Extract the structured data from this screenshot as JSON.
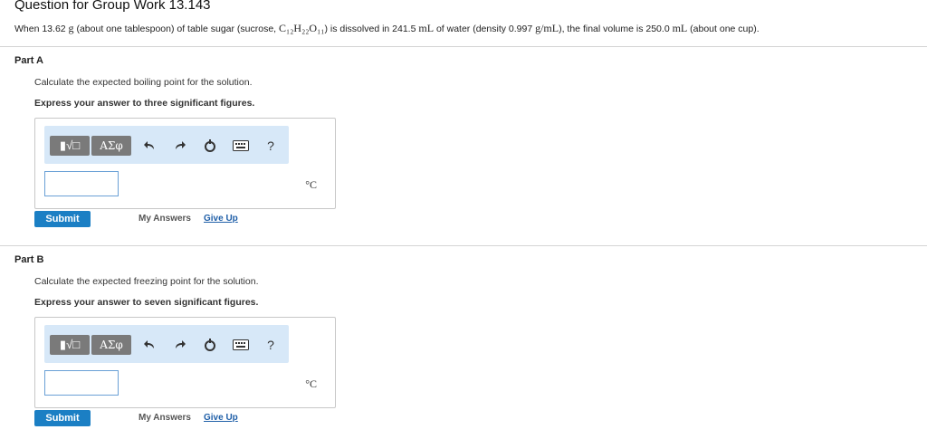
{
  "page": {
    "title": "Question for Group Work 13.143",
    "intro": {
      "t1": "When 13.62 ",
      "m1": "g",
      "t2": " (about one tablespoon) of table sugar (sucrose, ",
      "m2": "C₁₂H₂₂O₁₁",
      "t3": ") is dissolved in 241.5 ",
      "m3": "mL",
      "t4": " of water (density 0.997 ",
      "m4": "g/mL",
      "t5": "), the final volume is 250.0 ",
      "m5": "mL",
      "t6": " (about one cup)."
    }
  },
  "toolbar": {
    "templates_label": "▮√□",
    "greek_label": "ΑΣφ",
    "undo_icon": "undo-icon",
    "redo_icon": "redo-icon",
    "reset_icon": "reset-icon",
    "keyboard_icon": "keyboard-icon",
    "help_label": "?"
  },
  "parts": [
    {
      "label": "Part A",
      "prompt": "Calculate the expected boiling point for the solution.",
      "instruction": "Express your answer to three significant figures.",
      "unit": "°C",
      "answer_value": "",
      "submit": "Submit",
      "my_answers": "My Answers",
      "give_up": "Give Up"
    },
    {
      "label": "Part B",
      "prompt": "Calculate the expected freezing point for the solution.",
      "instruction": "Express your answer to seven significant figures.",
      "unit": "°C",
      "answer_value": "",
      "submit": "Submit",
      "my_answers": "My Answers",
      "give_up": "Give Up"
    }
  ],
  "colors": {
    "submit_bg": "#1b7fc4",
    "toolbar_bg": "#d7e8f8",
    "link": "#1f5fa8"
  }
}
